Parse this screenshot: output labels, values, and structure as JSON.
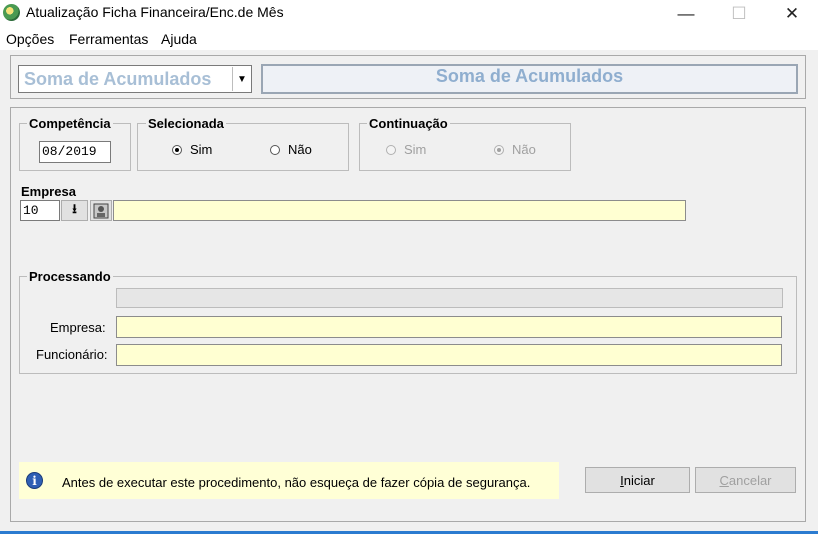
{
  "window": {
    "title": "Atualização Ficha Financeira/Enc.de Mês",
    "minimize_glyph": "—",
    "maximize_glyph": "☐",
    "close_glyph": "✕",
    "app_icon": "app-globe-icon"
  },
  "menu": {
    "items": [
      "Opções",
      "Ferramentas",
      "Ajuda"
    ]
  },
  "selector": {
    "value": "Soma de Acumulados",
    "arrow": "▼"
  },
  "header": {
    "title": "Soma de Acumulados"
  },
  "competencia": {
    "label": "Competência",
    "value": "08/2019"
  },
  "selecionada": {
    "label": "Selecionada",
    "opt_yes": "Sim",
    "opt_no": "Não",
    "selected": "Sim"
  },
  "continuacao": {
    "label": "Continuação",
    "opt_yes": "Sim",
    "opt_no": "Não",
    "selected": "Não",
    "enabled": false
  },
  "empresa": {
    "label": "Empresa",
    "code": "10",
    "name": "",
    "download_glyph": "⭳"
  },
  "processando": {
    "label": "Processando",
    "progress": 0,
    "empresa_label": "Empresa:",
    "empresa_value": "",
    "funcionario_label": "Funcionário:",
    "funcionario_value": ""
  },
  "info": {
    "icon": "info-icon",
    "text": "Antes de executar este procedimento, não esqueça de fazer cópia de segurança."
  },
  "buttons": {
    "start": {
      "mnemonic": "I",
      "rest": "niciar"
    },
    "cancel": {
      "mnemonic": "C",
      "rest": "ancelar",
      "enabled": false
    }
  },
  "colors": {
    "field_yellow": "#ffffd2",
    "header_text": "#8faecf",
    "info_bg": "#ffffd6"
  }
}
